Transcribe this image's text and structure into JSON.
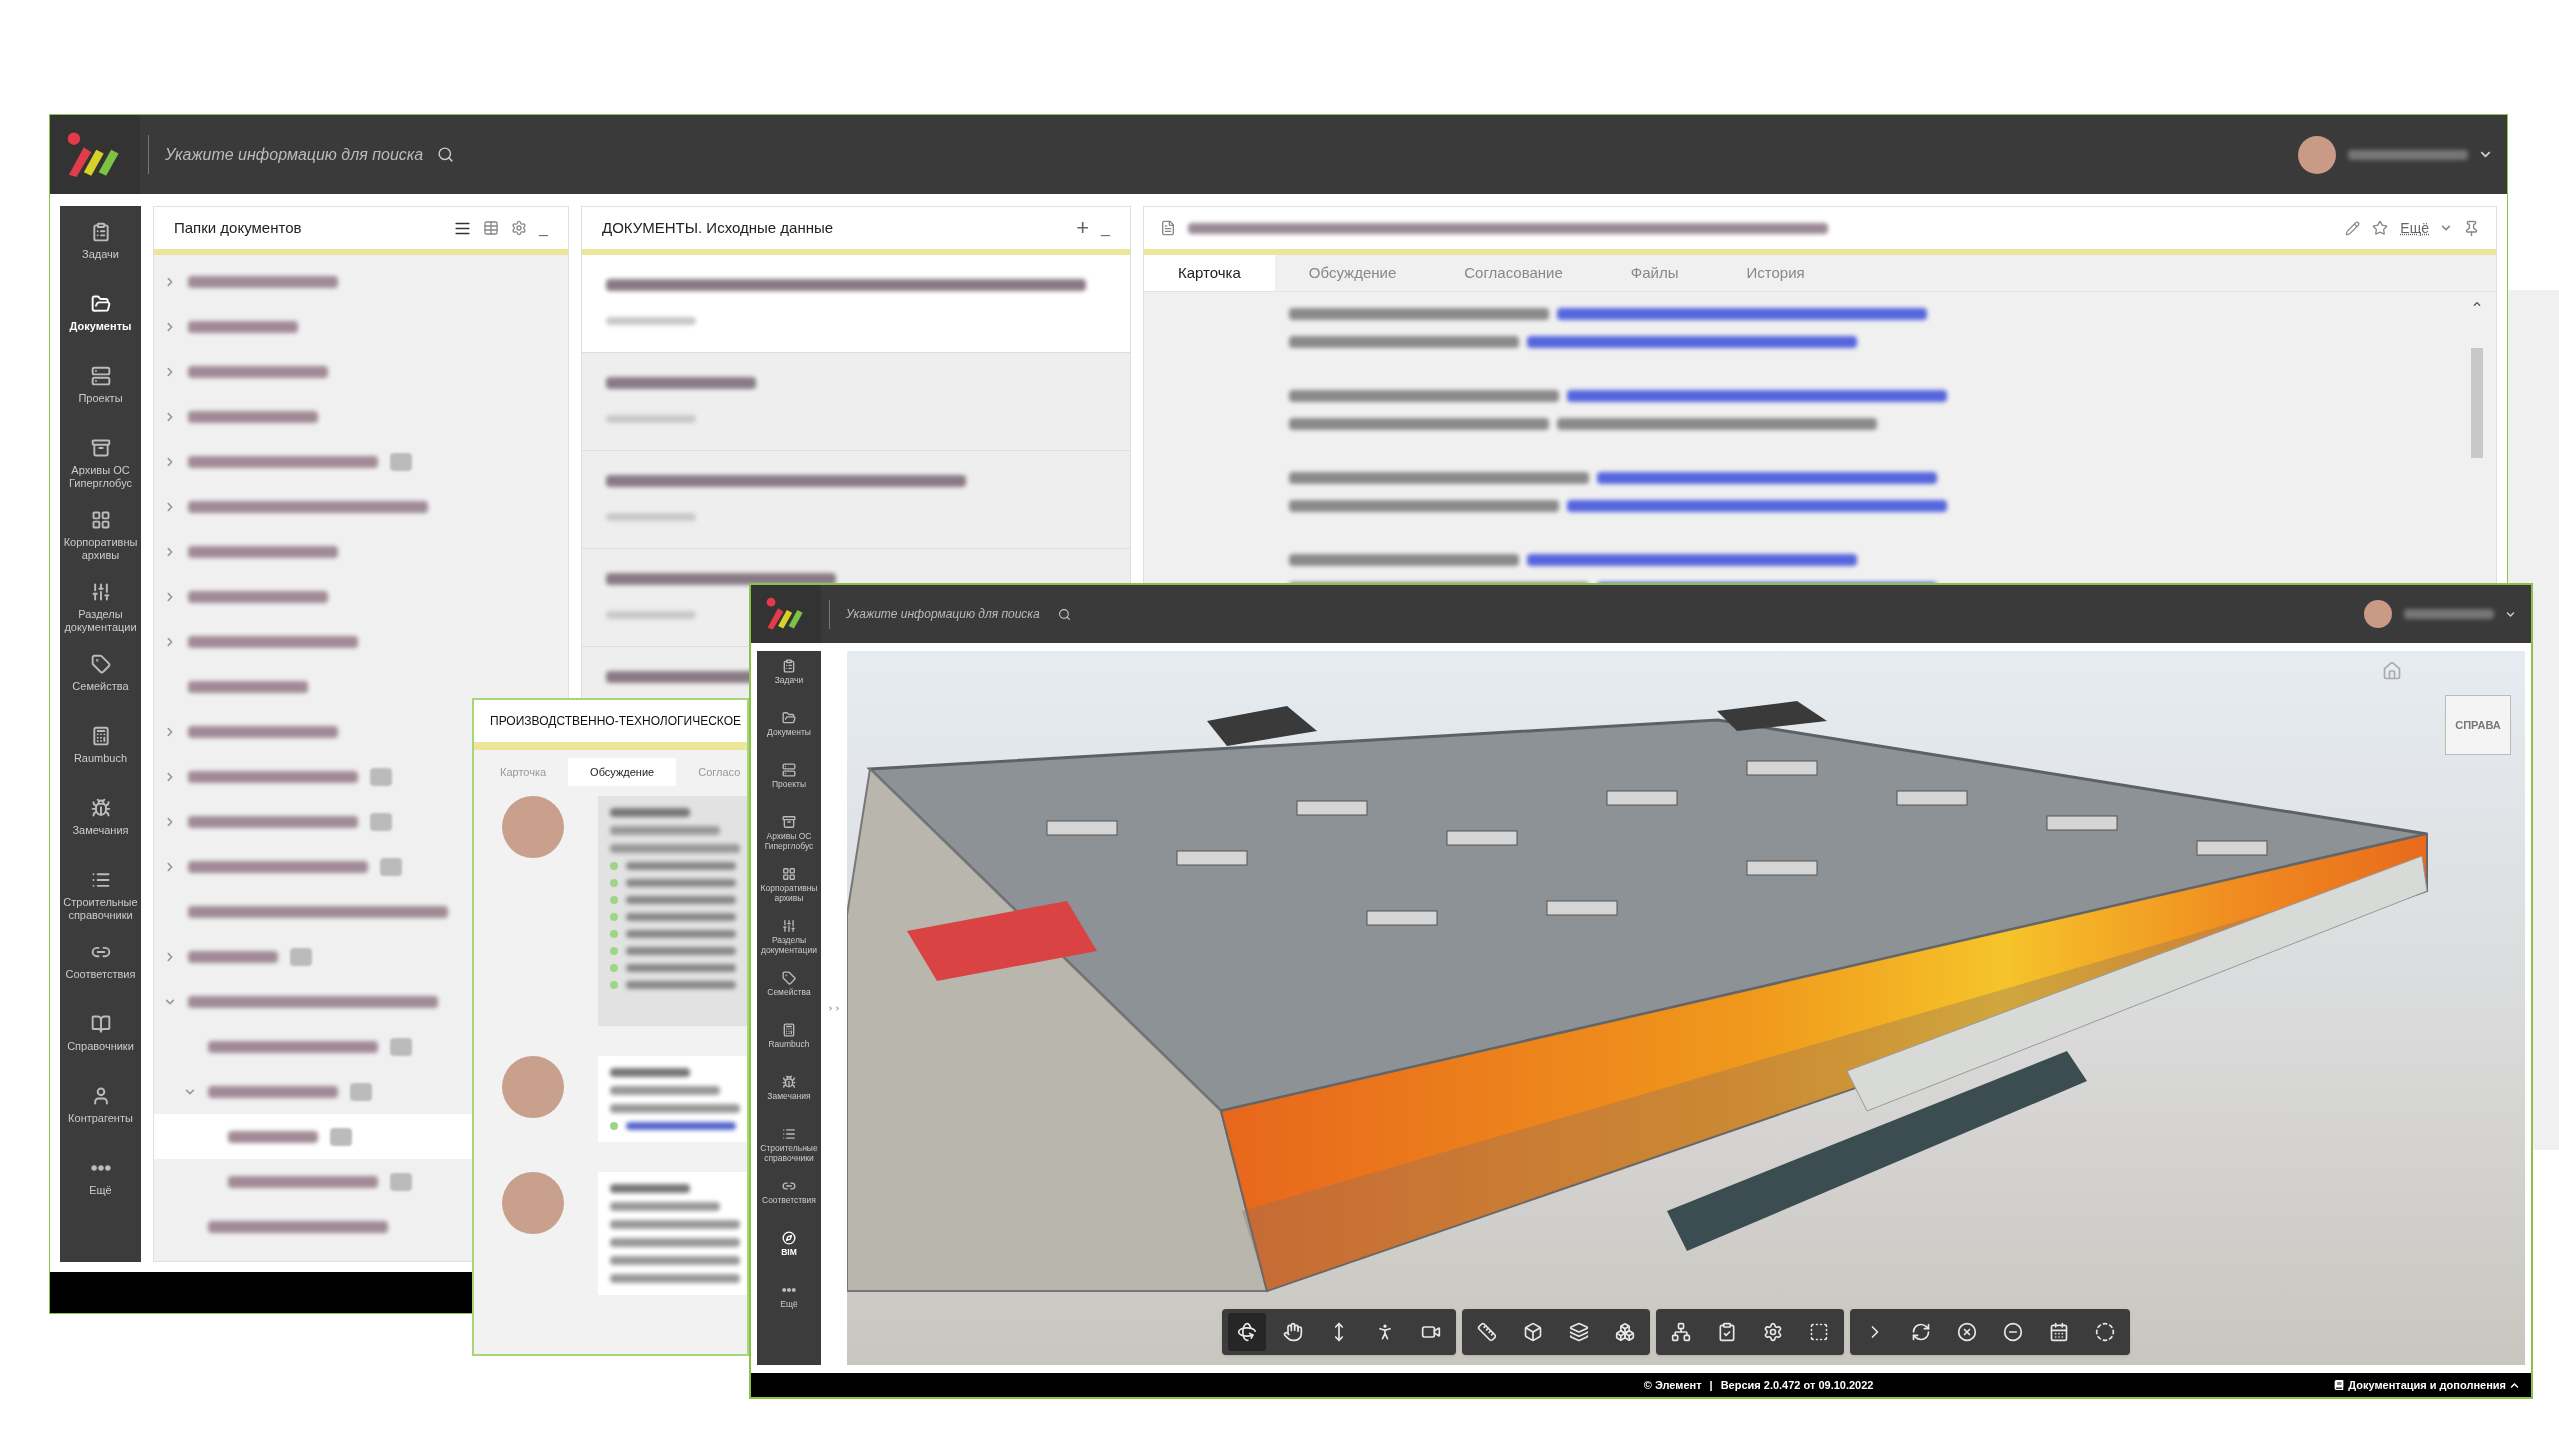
{
  "back_window": {
    "search": {
      "placeholder": "Укажите информацию для поиска"
    },
    "nav": [
      {
        "label": "Задачи",
        "selected": false
      },
      {
        "label": "Документы",
        "selected": true
      },
      {
        "label": "Проекты",
        "selected": false
      },
      {
        "label": "Архивы ОС Гиперглобус",
        "selected": false
      },
      {
        "label": "Корпоративны архивы",
        "selected": false
      },
      {
        "label": "Разделы документации",
        "selected": false
      },
      {
        "label": "Семейства",
        "selected": false
      },
      {
        "label": "Raumbuch",
        "selected": false
      },
      {
        "label": "Замечания",
        "selected": false
      },
      {
        "label": "Строительные справочники",
        "selected": false
      },
      {
        "label": "Соответствия",
        "selected": false
      },
      {
        "label": "Справочники",
        "selected": false
      },
      {
        "label": "Контрагенты",
        "selected": false
      },
      {
        "label": "Ещё",
        "selected": false
      }
    ],
    "folders_panel": {
      "title": "Папки документов",
      "minimize": "_",
      "tree": [
        {
          "kind": "group",
          "expanded": false,
          "badge": false,
          "selected": false
        },
        {
          "kind": "group",
          "expanded": false,
          "badge": false,
          "selected": false
        },
        {
          "kind": "group",
          "expanded": false,
          "badge": false,
          "selected": false
        },
        {
          "kind": "group",
          "expanded": false,
          "badge": false,
          "selected": false
        },
        {
          "kind": "group",
          "expanded": false,
          "badge": true,
          "selected": false
        },
        {
          "kind": "group",
          "expanded": false,
          "badge": false,
          "selected": false
        },
        {
          "kind": "group",
          "expanded": false,
          "badge": false,
          "selected": false
        },
        {
          "kind": "group",
          "expanded": false,
          "badge": false,
          "selected": false
        },
        {
          "kind": "group",
          "expanded": false,
          "badge": false,
          "selected": false
        },
        {
          "kind": "leaf",
          "badge": false,
          "selected": false
        },
        {
          "kind": "group",
          "expanded": false,
          "badge": false,
          "selected": false
        },
        {
          "kind": "group",
          "expanded": false,
          "badge": true,
          "selected": false
        },
        {
          "kind": "group",
          "expanded": false,
          "badge": true,
          "selected": false
        },
        {
          "kind": "group",
          "expanded": false,
          "badge": true,
          "selected": false
        },
        {
          "kind": "leaf",
          "badge": false,
          "selected": false
        },
        {
          "kind": "group",
          "expanded": false,
          "badge": true,
          "selected": false
        },
        {
          "kind": "group",
          "expanded": true,
          "badge": false,
          "selected": false,
          "children": [
            {
              "kind": "leaf",
              "badge": true,
              "selected": false
            },
            {
              "kind": "group",
              "expanded": true,
              "badge": true,
              "selected": false,
              "children": [
                {
                  "kind": "leaf",
                  "badge": true,
                  "selected": true
                },
                {
                  "kind": "leaf",
                  "badge": true,
                  "selected": false
                }
              ]
            },
            {
              "kind": "leaf",
              "badge": false,
              "selected": false
            }
          ]
        }
      ]
    },
    "documents_panel": {
      "title": "ДОКУМЕНТЫ. Исходные данные",
      "add": "+",
      "minimize": "_",
      "items": [
        {
          "selected": true
        },
        {
          "selected": false
        },
        {
          "selected": false
        },
        {
          "selected": false
        },
        {
          "selected": false
        }
      ]
    },
    "card_panel": {
      "more": "Ещё",
      "tabs": [
        {
          "label": "Карточка",
          "selected": true
        },
        {
          "label": "Обсуждение",
          "selected": false
        },
        {
          "label": "Согласование",
          "selected": false
        },
        {
          "label": "Файлы",
          "selected": false
        },
        {
          "label": "История",
          "selected": false
        }
      ],
      "body_lines": [
        {
          "kind": "link"
        },
        {
          "kind": "link"
        },
        {
          "kind": "spacer"
        },
        {
          "kind": "link"
        },
        {
          "kind": "plain"
        },
        {
          "kind": "spacer"
        },
        {
          "kind": "link"
        },
        {
          "kind": "link"
        },
        {
          "kind": "spacer"
        },
        {
          "kind": "link"
        },
        {
          "kind": "link"
        }
      ]
    }
  },
  "middle_window": {
    "title": "ПРОИЗВОДСТВЕННО-ТЕХНОЛОГИЧЕСКОЕ",
    "tabs": [
      {
        "label": "Карточка",
        "selected": false
      },
      {
        "label": "Обсуждение",
        "selected": true
      },
      {
        "label": "Согласо",
        "selected": false
      }
    ],
    "comments": [
      {
        "kind": "files"
      },
      {
        "kind": "file"
      },
      {
        "kind": "text"
      }
    ]
  },
  "front_window": {
    "search": {
      "placeholder": "Укажите информацию для поиска"
    },
    "nav": [
      {
        "label": "Задачи",
        "selected": false
      },
      {
        "label": "Документы",
        "selected": false
      },
      {
        "label": "Проекты",
        "selected": false
      },
      {
        "label": "Архивы ОС Гиперглобус",
        "selected": false
      },
      {
        "label": "Корпоративны архивы",
        "selected": false
      },
      {
        "label": "Разделы документации",
        "selected": false
      },
      {
        "label": "Семейства",
        "selected": false
      },
      {
        "label": "Raumbuch",
        "selected": false
      },
      {
        "label": "Замечания",
        "selected": false
      },
      {
        "label": "Строительные справочники",
        "selected": false
      },
      {
        "label": "Соответствия",
        "selected": false
      },
      {
        "label": "BIM",
        "selected": true
      },
      {
        "label": "Ещё",
        "selected": false
      }
    ],
    "view_cube": {
      "label": "СПРАВА"
    },
    "toolbar": [
      {
        "tools": [
          {
            "selected": true
          },
          {
            "selected": false
          },
          {
            "selected": false
          },
          {
            "selected": false
          },
          {
            "selected": false
          }
        ]
      },
      {
        "tools": [
          {
            "selected": false
          },
          {
            "selected": false
          },
          {
            "selected": false
          },
          {
            "selected": false
          }
        ]
      },
      {
        "tools": [
          {
            "selected": false
          },
          {
            "selected": false
          },
          {
            "selected": false
          },
          {
            "selected": false
          }
        ]
      },
      {
        "tools": [
          {
            "selected": false
          },
          {
            "selected": false
          },
          {
            "selected": false
          },
          {
            "selected": false
          },
          {
            "selected": false
          },
          {
            "selected": false
          }
        ]
      }
    ],
    "status_bar": {
      "copyright": "© Элемент",
      "separator": "|",
      "version": "Версия 2.0.472 от 09.10.2022",
      "docs_link": "Документация и дополнения"
    }
  }
}
